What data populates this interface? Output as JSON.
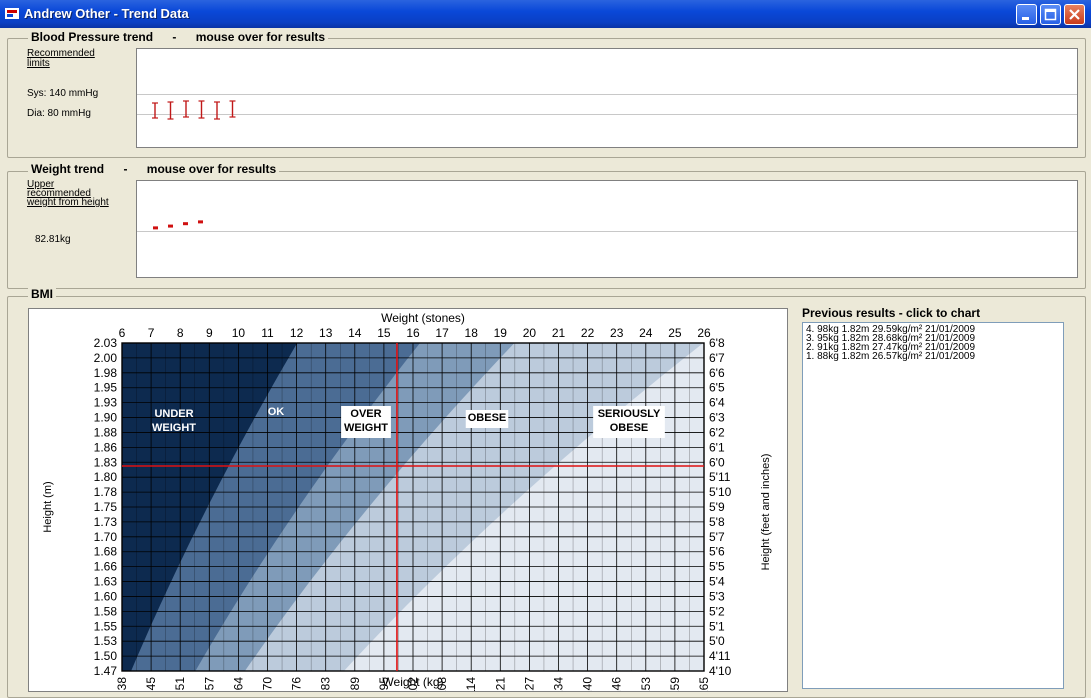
{
  "window": {
    "title": "Andrew Other - Trend Data",
    "buttons": {
      "minimize": "minimize",
      "maximize": "maximize",
      "close": "close"
    }
  },
  "bp": {
    "label": "Blood Pressure trend",
    "dash": "-",
    "hint": "mouse over for results",
    "limits_label_1": "Recommended",
    "limits_label_2": "limits",
    "sys": "Sys: 140 mmHg",
    "dia": "Dia: 80 mmHg",
    "readings": [
      1,
      2,
      3,
      4,
      5,
      6
    ]
  },
  "weight": {
    "label": "Weight trend",
    "dash": "-",
    "hint": "mouse over for results",
    "upper_1": "Upper",
    "upper_2": "recommended",
    "upper_3": "weight from height",
    "upper_value": "82.81kg",
    "readings": [
      88,
      91,
      95,
      98
    ]
  },
  "bmi": {
    "label": "BMI",
    "previous_label": "Previous results - click to chart",
    "results": [
      "4.  98kg 1.82m 29.59kg/m²  21/01/2009",
      "3.  95kg 1.82m 28.68kg/m²  21/01/2009",
      "2.  91kg 1.82m 27.47kg/m²  21/01/2009",
      "1.  88kg 1.82m 26.57kg/m²  21/01/2009"
    ]
  },
  "chart_data": {
    "type": "heatmap",
    "title": "",
    "top_axis_label": "Weight (stones)",
    "xlabel": "Weight (kg)",
    "ylabel": "Height (m)",
    "right_axis_label": "Height (feet and inches)",
    "stones_ticks": [
      "6",
      "7",
      "8",
      "9",
      "10",
      "11",
      "12",
      "13",
      "14",
      "15",
      "16",
      "17",
      "18",
      "19",
      "20",
      "21",
      "22",
      "23",
      "24",
      "25",
      "26"
    ],
    "kg_ticks": [
      "38",
      "45",
      "51",
      "57",
      "64",
      "70",
      "76",
      "83",
      "89",
      "95",
      "102",
      "108",
      "114",
      "121",
      "127",
      "134",
      "140",
      "146",
      "153",
      "159",
      "165"
    ],
    "height_ticks": [
      "2.03",
      "2.00",
      "1.98",
      "1.95",
      "1.93",
      "1.90",
      "1.88",
      "1.86",
      "1.83",
      "1.80",
      "1.78",
      "1.75",
      "1.73",
      "1.70",
      "1.68",
      "1.66",
      "1.63",
      "1.60",
      "1.58",
      "1.55",
      "1.53",
      "1.50",
      "1.47"
    ],
    "feet_ticks": [
      "6'8",
      "6'7",
      "6'6",
      "6'5",
      "6'4",
      "6'3",
      "6'2",
      "6'1",
      "6'0",
      "5'11",
      "5'10",
      "5'9",
      "5'8",
      "5'7",
      "5'6",
      "5'5",
      "5'4",
      "5'3",
      "5'2",
      "5'1",
      "5'0",
      "4'11",
      "4'10"
    ],
    "xlim": [
      38,
      165
    ],
    "ylim": [
      1.47,
      2.03
    ],
    "bands": [
      {
        "label": "UNDER WEIGHT",
        "bmi_max": 18.5,
        "color": "#0d2a4f"
      },
      {
        "label": "OK",
        "bmi_max": 25,
        "color": "#4b6c94"
      },
      {
        "label": "OVER WEIGHT",
        "bmi_max": 30,
        "color": "#7f9bb9"
      },
      {
        "label": "OBESE",
        "bmi_max": 40,
        "color": "#bccbdc"
      },
      {
        "label": "SERIOUSLY OBESE",
        "bmi_max": null,
        "color": "#e3e9f1"
      }
    ],
    "marker": {
      "weight_kg": 98,
      "height_m": 1.82,
      "color": "#e01010"
    }
  }
}
